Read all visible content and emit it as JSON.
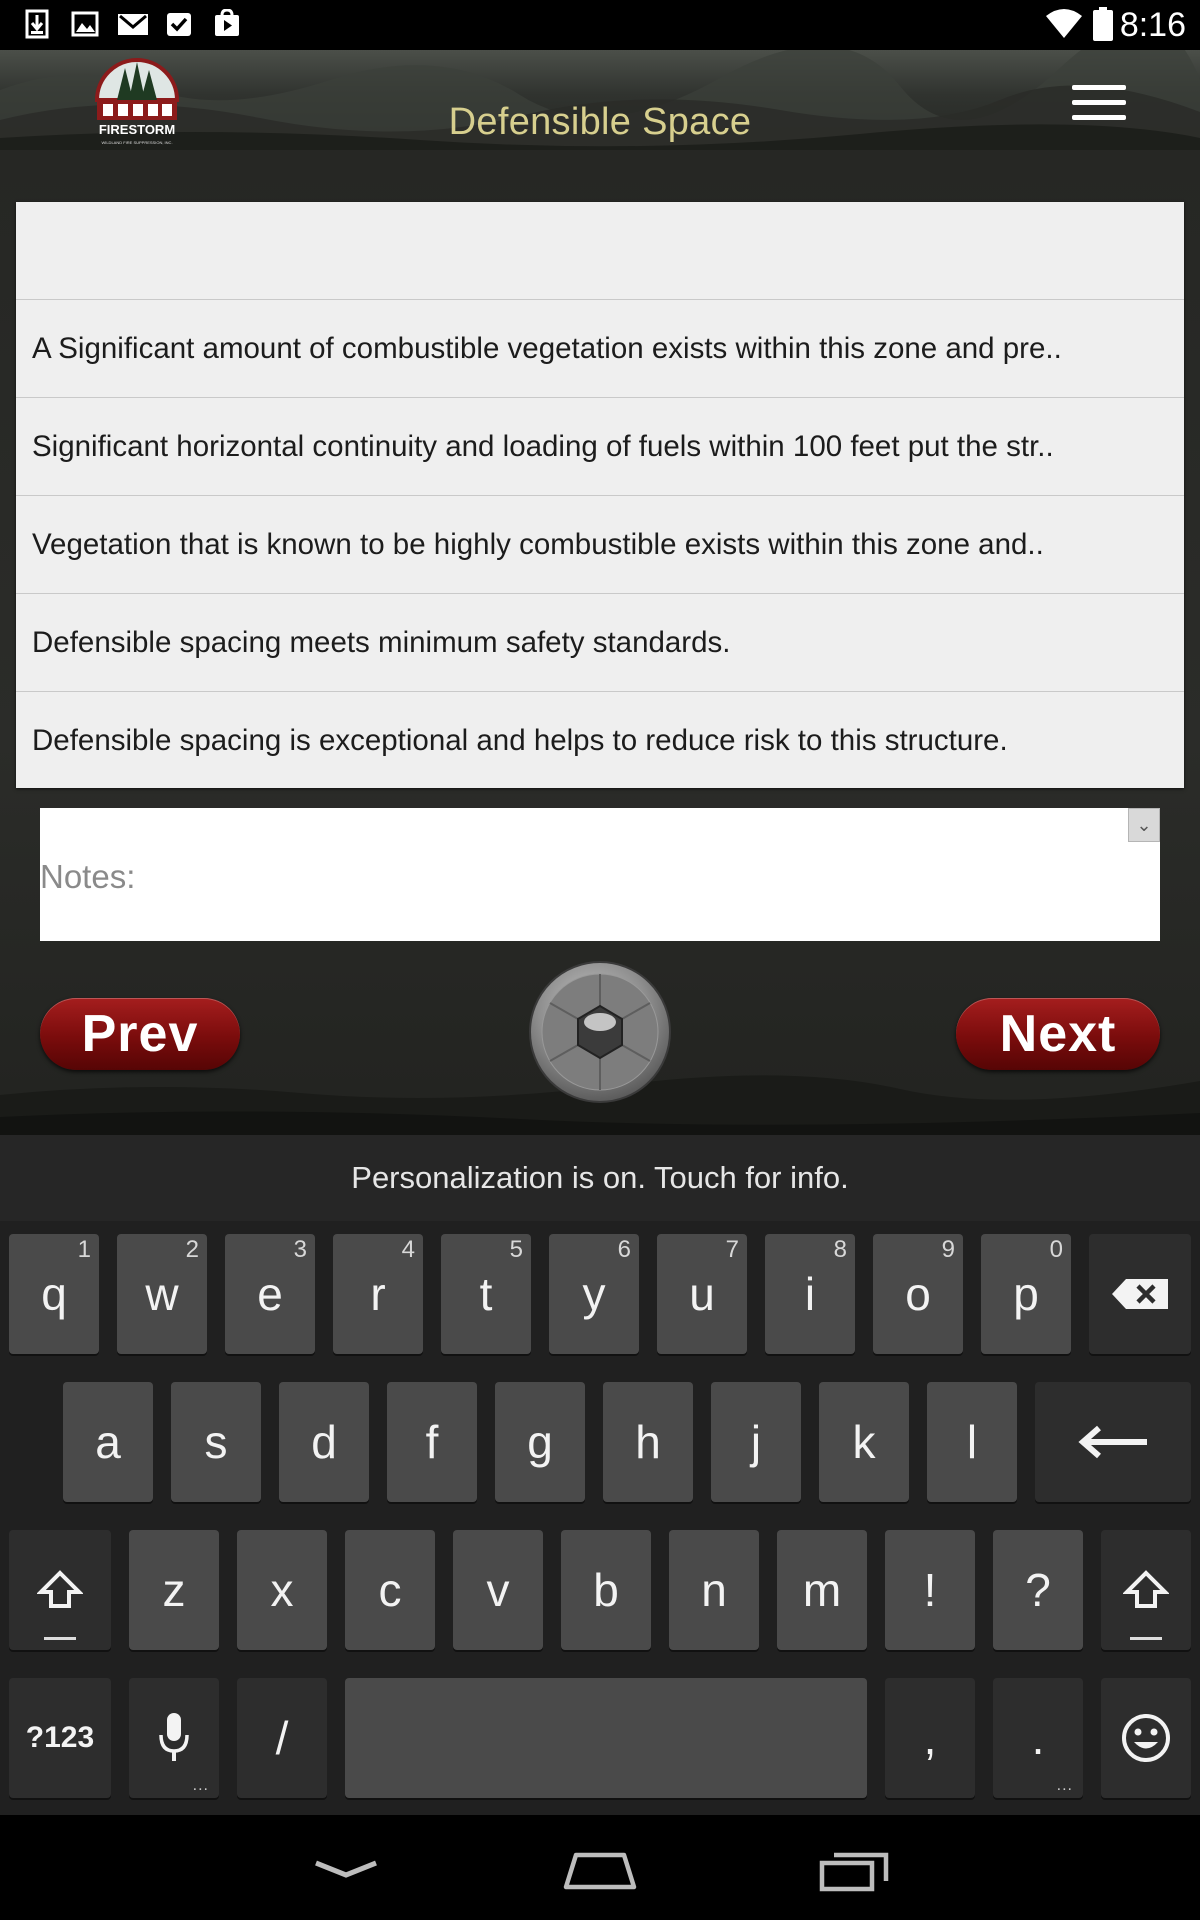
{
  "status_bar": {
    "time": "8:16",
    "left_icons": [
      "download-icon",
      "image-icon",
      "gmail-icon",
      "task-check-icon",
      "play-store-icon"
    ],
    "right_icons": [
      "wifi-icon",
      "battery-icon"
    ]
  },
  "header": {
    "title": "Defensible Space",
    "logo_text": "FIRESTORM",
    "logo_subtext": "WILDLAND FIRE SUPPRESSION, INC.",
    "menu_icon": "hamburger-menu-icon"
  },
  "options": {
    "items": [
      "",
      "A Significant amount of combustible vegetation exists within this zone and pre..",
      "Significant horizontal continuity and loading of fuels within 100 feet put the str..",
      "Vegetation that is known to be highly combustible exists within this zone and..",
      "Defensible spacing meets minimum safety standards.",
      "Defensible spacing is exceptional and helps to reduce risk to this structure."
    ]
  },
  "notes": {
    "placeholder": "Notes:",
    "value": ""
  },
  "navigation": {
    "prev_label": "Prev",
    "next_label": "Next",
    "camera_icon": "camera-shutter-icon"
  },
  "keyboard": {
    "suggestion_text": "Personalization is on. Touch for info.",
    "row1": [
      {
        "label": "q",
        "hint": "1"
      },
      {
        "label": "w",
        "hint": "2"
      },
      {
        "label": "e",
        "hint": "3"
      },
      {
        "label": "r",
        "hint": "4"
      },
      {
        "label": "t",
        "hint": "5"
      },
      {
        "label": "y",
        "hint": "6"
      },
      {
        "label": "u",
        "hint": "7"
      },
      {
        "label": "i",
        "hint": "8"
      },
      {
        "label": "o",
        "hint": "9"
      },
      {
        "label": "p",
        "hint": "0"
      }
    ],
    "row2": [
      "a",
      "s",
      "d",
      "f",
      "g",
      "h",
      "j",
      "k",
      "l"
    ],
    "row3": [
      "z",
      "x",
      "c",
      "v",
      "b",
      "n",
      "m",
      "!",
      "?"
    ],
    "symbols_label": "?123",
    "slash_label": "/",
    "comma_label": ",",
    "period_label": "."
  },
  "nav_bar": {
    "icons": [
      "back-icon",
      "home-icon",
      "recents-icon"
    ]
  }
}
